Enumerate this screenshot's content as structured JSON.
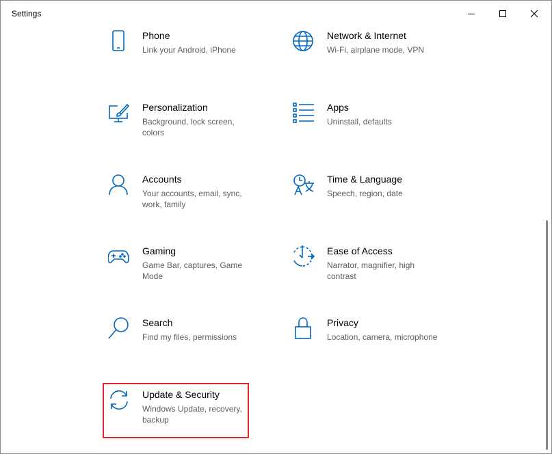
{
  "window": {
    "title": "Settings",
    "minimize_icon": "minimize-icon",
    "maximize_icon": "maximize-icon",
    "close_icon": "close-icon"
  },
  "accent_color": "#0067c0",
  "highlight_color": "#e3262c",
  "tiles": [
    {
      "name": "Phone",
      "desc": "Link your Android, iPhone",
      "icon": "phone-icon"
    },
    {
      "name": "Network & Internet",
      "desc": "Wi-Fi, airplane mode, VPN",
      "icon": "globe-icon"
    },
    {
      "name": "Personalization",
      "desc": "Background, lock screen, colors",
      "icon": "paint-monitor-icon"
    },
    {
      "name": "Apps",
      "desc": "Uninstall, defaults",
      "icon": "apps-list-icon"
    },
    {
      "name": "Accounts",
      "desc": "Your accounts, email, sync, work, family",
      "icon": "person-icon"
    },
    {
      "name": "Time & Language",
      "desc": "Speech, region, date",
      "icon": "time-language-icon"
    },
    {
      "name": "Gaming",
      "desc": "Game Bar, captures, Game Mode",
      "icon": "gamepad-icon"
    },
    {
      "name": "Ease of Access",
      "desc": "Narrator, magnifier, high contrast",
      "icon": "ease-of-access-icon"
    },
    {
      "name": "Search",
      "desc": "Find my files, permissions",
      "icon": "search-icon"
    },
    {
      "name": "Privacy",
      "desc": "Location, camera, microphone",
      "icon": "lock-icon"
    },
    {
      "name": "Update & Security",
      "desc": "Windows Update, recovery, backup",
      "icon": "sync-arrows-icon"
    }
  ]
}
